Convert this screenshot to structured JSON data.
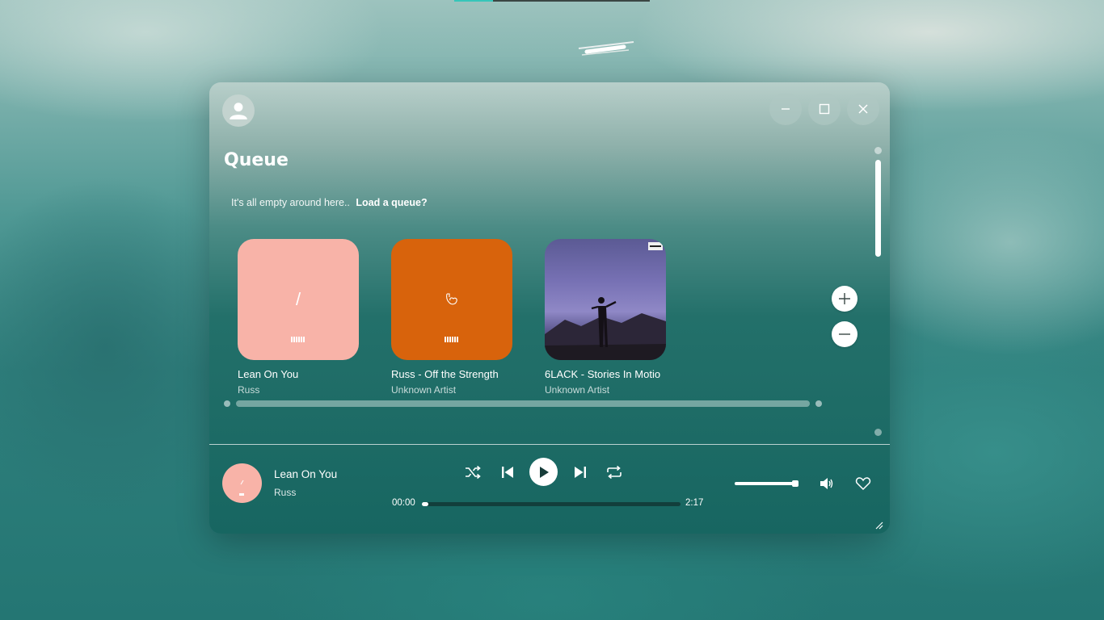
{
  "colors": {
    "accent": "#36c6b9",
    "card1_bg": "#f8b3a8",
    "card2_bg": "#d8630c",
    "progress_track": "#123f3c"
  },
  "window": {
    "user_icon": "user-icon",
    "controls": {
      "minimize": "minimize-icon",
      "maximize": "maximize-icon",
      "close": "close-icon"
    }
  },
  "page": {
    "title": "Queue",
    "empty_text": "It's all empty around here..",
    "load_link": "Load a queue?"
  },
  "cards": [
    {
      "title": "Lean On You",
      "artist": "Russ",
      "art_glyph": "/"
    },
    {
      "title": "Russ - Off the Strength",
      "artist": "Unknown Artist",
      "art_glyph": ""
    },
    {
      "title": "6LACK - Stories In Motio",
      "artist": "Unknown Artist",
      "art_glyph": ""
    }
  ],
  "zoom": {
    "in_icon": "plus-icon",
    "out_icon": "minus-icon"
  },
  "now_playing": {
    "title": "Lean On You",
    "artist": "Russ",
    "current_time": "00:00",
    "total_time": "2:17",
    "progress_fraction": 0.01,
    "volume_fraction": 1.0,
    "icons": [
      "shuffle-icon",
      "previous-icon",
      "play-icon",
      "next-icon",
      "repeat-icon",
      "volume-icon",
      "heart-icon"
    ]
  }
}
